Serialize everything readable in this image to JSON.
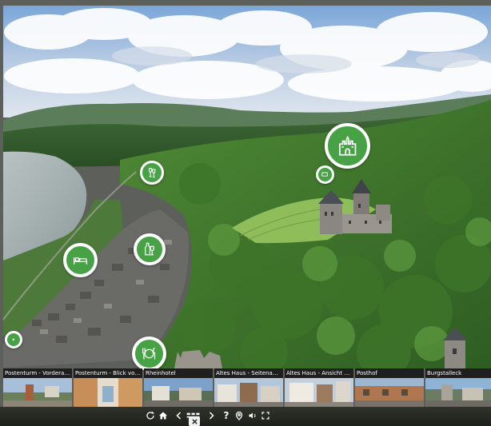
{
  "hotspots": [
    {
      "icon": "castle-icon",
      "accent": "#46a245"
    },
    {
      "icon": "wine-glasses-icon",
      "accent": "#46a245"
    },
    {
      "icon": "chat-bubble-icon",
      "accent": "#46a245"
    },
    {
      "icon": "wine-bottle-icon",
      "accent": "#46a245"
    },
    {
      "icon": "bed-icon",
      "accent": "#46a245"
    },
    {
      "icon": "restaurant-icon",
      "accent": "#46a245"
    },
    {
      "icon": "hotspot-icon",
      "accent": "#46a245"
    }
  ],
  "thumbnails": [
    {
      "label": "Postenturm - Vorderansicht"
    },
    {
      "label": "Postenturm - Blick von oben"
    },
    {
      "label": "Rheinhotel"
    },
    {
      "label": "Altes Haus - Seitenansicht"
    },
    {
      "label": "Altes Haus - Ansicht der Vor..."
    },
    {
      "label": "Posthof"
    },
    {
      "label": "Burgstalleck"
    }
  ],
  "controls": {
    "help_label": "?",
    "icons": [
      "rotate-icon",
      "home-icon",
      "prev-icon",
      "thumbnails-icon",
      "next-icon",
      "help-icon",
      "map-pin-icon",
      "sound-icon",
      "fullscreen-icon",
      "close-icon"
    ]
  }
}
